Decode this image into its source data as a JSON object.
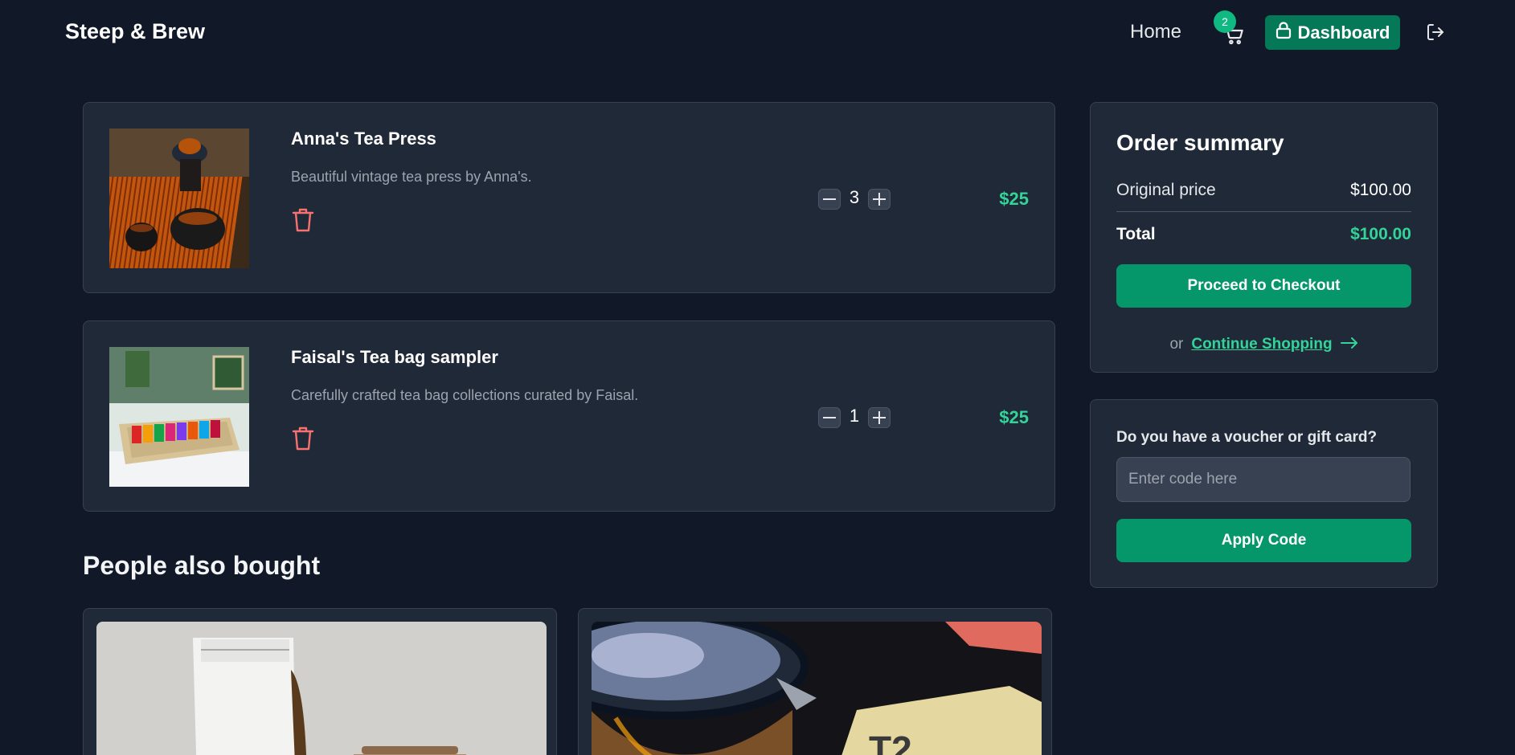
{
  "nav": {
    "brand": "Steep & Brew",
    "home_label": "Home",
    "cart_count": "2",
    "dashboard_label": "Dashboard"
  },
  "cart": {
    "items": [
      {
        "title": "Anna's Tea Press",
        "description": "Beautiful vintage tea press by Anna's.",
        "quantity": "3",
        "price": "$25"
      },
      {
        "title": "Faisal's Tea bag sampler",
        "description": "Carefully crafted tea bag collections curated by Faisal.",
        "quantity": "1",
        "price": "$25"
      }
    ]
  },
  "recommendations": {
    "title": "People also bought"
  },
  "summary": {
    "title": "Order summary",
    "original_price_label": "Original price",
    "original_price_value": "$100.00",
    "total_label": "Total",
    "total_value": "$100.00",
    "checkout_label": "Proceed to Checkout",
    "or_text": "or",
    "continue_label": "Continue Shopping"
  },
  "voucher": {
    "label": "Do you have a voucher or gift card?",
    "placeholder": "Enter code here",
    "value": "",
    "apply_label": "Apply Code"
  },
  "colors": {
    "background": "#111827",
    "card": "#1f2937",
    "accent": "#059669",
    "price": "#34d399",
    "danger": "#f87171"
  }
}
